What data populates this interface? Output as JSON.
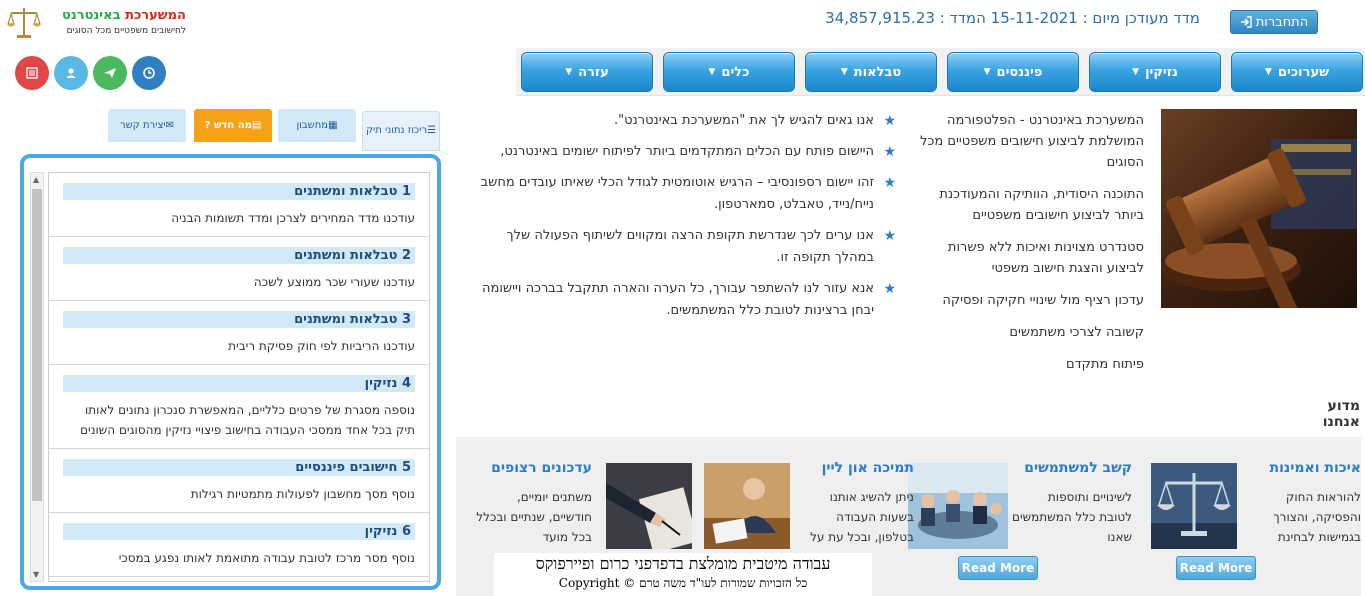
{
  "header": {
    "login_label": "התחברות",
    "index_text": "מדד מעודכן מיום : 15-11-2021 המדד : 34,857,915.23",
    "logo": {
      "title_red": "המשערכת",
      "title_green": "באינטרנט",
      "subtitle": "לחישובים משפטיים מכל הסוגים"
    }
  },
  "round_buttons": [
    {
      "icon": "list-icon",
      "color": "#e04848"
    },
    {
      "icon": "user-icon",
      "color": "#5ab8e4"
    },
    {
      "icon": "send-icon",
      "color": "#4cb860"
    },
    {
      "icon": "clock-icon",
      "color": "#2f7fc1"
    }
  ],
  "nav": {
    "items": [
      "שערוכים",
      "נזיקין",
      "פיננסים",
      "טבלאות",
      "כלים",
      "עזרה"
    ]
  },
  "side_tabs": [
    {
      "label": "ריכוז נתוני תיק",
      "icon": "list-icon"
    },
    {
      "label": "מחשבון",
      "icon": "calculator-icon"
    },
    {
      "label": "מה חדש ?",
      "icon": "news-icon"
    },
    {
      "label": "יצירת קשר",
      "icon": "envelope-icon"
    }
  ],
  "updates": [
    {
      "num": "1",
      "category": "טבלאות ומשתנים",
      "text": "עודכנו מדד המחירים לצרכן ומדד תשומות הבניה"
    },
    {
      "num": "2",
      "category": "טבלאות ומשתנים",
      "text": "עודכנו שעורי שכר ממוצע לשכה"
    },
    {
      "num": "3",
      "category": "טבלאות ומשתנים",
      "text": "עודכנו הריביות לפי חוק פסיקת ריבית"
    },
    {
      "num": "4",
      "category": "נזיקין",
      "text": "נוספה מסגרת של פרטים כלליים, המאפשרת סנכרון נתונים לאותו תיק בכל אחד ממסכי העבודה בחישוב פיצויי נזיקין מהסוגים השונים"
    },
    {
      "num": "5",
      "category": "חישובים פיננסיים",
      "text": "נוסף מסך מחשבון לפעולות מתמטיות רגילות"
    },
    {
      "num": "6",
      "category": "נזיקין",
      "text": "נוסף מסר מרכז לטובת עבודה מתואמת לאותו נפגע במסכי"
    }
  ],
  "intro": {
    "right_paragraphs": [
      "המשערכת באינטרנט - הפלטפורמה המושלמת לביצוע חישובים משפטיים מכל הסוגים",
      "התוכנה היסודית, הוותיקה והמעודכנת ביותר לביצוע חישובים משפטיים",
      "סטנדרט מצוינות ואיכות ללא פשרות לביצוע והצגת חישוב משפטי",
      "עדכון רציף מול שינויי חקיקה ופסיקה",
      "קשובה לצרכי משתמשים",
      "פיתוח מתקדם"
    ],
    "left_bullets": [
      "אנו גאים להגיש לך את \"המשערכת באינטרנט\".",
      "היישום פותח עם הכלים המתקדמים ביותר לפיתוח ישומים באינטרנט,",
      "זהו יישום רספונסיבי – הרגיש אוטומטית לגודל הכלי שאיתו עובדים מחשב נייח/נייד, טאבלט, סמארטפון.",
      "אנו ערים לכך שנדרשת תקופת הרצה ומקווים לשיתוף הפעולה שלך במהלך תקופה זו.",
      "אנא עזור לנו להשתפר עבורך, כל הערה והארה תתקבל בברכה ויישומה יבחן ברצינות לטובת כלל המשתמשים."
    ]
  },
  "why_title": "מדוע אנחנו",
  "features": [
    {
      "title": "איכות ואמינות",
      "text": "להוראות החוק והפסיקה, והצורך בגמישות לבחינת",
      "read_more": "Read More"
    },
    {
      "title": "קשב למשתמשים",
      "text": "לשינויים ותוספות לטובת כלל המשתמשים שאנו",
      "read_more": "Read More"
    },
    {
      "title": "תמיכה און ליין",
      "text": "ניתן להשיג אותנו בשעות העבודה בטלפון, ובכל עת על"
    },
    {
      "title": "עדכונים רצופים",
      "text": "משתנים יומיים, חודשיים, שנתיים ובכלל בכל מועד"
    }
  ],
  "footer": {
    "line1": "עבודה מיטבית מומלצת בדפדפני כרום ופיירפוקס",
    "line2": "כל הזכויות שמורות לעו\"ד משה טרם © Copyright"
  },
  "colors": {
    "accent_blue": "#2d7dc6",
    "tab_orange": "#f5a21a",
    "box_border": "#4aa9e3"
  }
}
